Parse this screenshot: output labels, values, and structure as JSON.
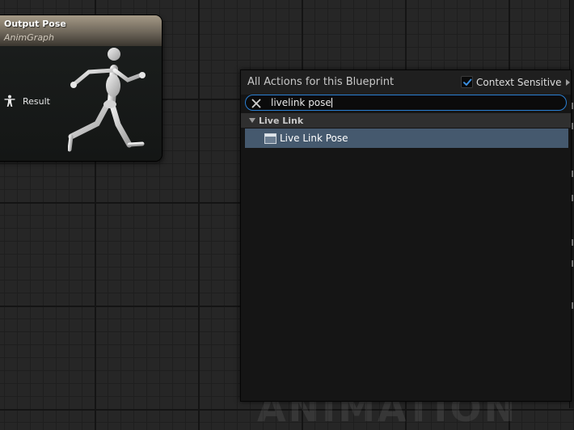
{
  "graph": {
    "watermark": "ANIMATION"
  },
  "node": {
    "title": "Output Pose",
    "subtitle": "AnimGraph",
    "pin": {
      "label": "Result",
      "icon": "person-pose-icon"
    },
    "preview_icon": "mannequin-running-icon"
  },
  "menu": {
    "title": "All Actions for this Blueprint",
    "context_sensitive": {
      "label": "Context Sensitive",
      "checked": true
    },
    "search": {
      "value": "livelink pose",
      "clear_icon": "close-icon"
    },
    "category": {
      "label": "Live Link",
      "expanded": true,
      "items": [
        {
          "label": "Live Link Pose",
          "icon": "function-node-icon",
          "selected": true
        }
      ]
    }
  },
  "colors": {
    "accent": "#2a7fd3",
    "selection": "#45596e",
    "node_header": "#a59a87",
    "check": "#3b8fe0"
  }
}
